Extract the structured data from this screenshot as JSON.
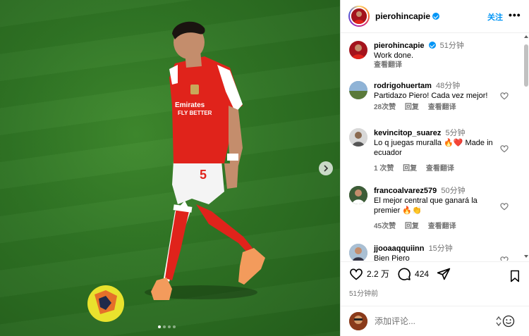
{
  "post": {
    "username": "pierohincapie",
    "follow_label": "关注",
    "more_label": "•••",
    "caption": {
      "username": "pierohincapie",
      "time": "51分钟",
      "text": "Work done.",
      "translate": "查看翻译"
    },
    "image": {
      "jersey_sponsor": "Emirates FLY BETTER",
      "jersey_number": "5",
      "carousel_dots": 4,
      "active_dot": 1
    }
  },
  "comments": [
    {
      "user": "rodrigohuertam",
      "time": "48分钟",
      "text": "Partidazo Piero! Cada vez mejor!",
      "likes": "28次赞",
      "reply": "回复",
      "translate": "查看翻译"
    },
    {
      "user": "kevincitop_suarez",
      "time": "5分钟",
      "text": "Lo q juegas muralla 🔥❤️ Made in ecuador",
      "likes": "1 次赞",
      "reply": "回复",
      "translate": "查看翻译"
    },
    {
      "user": "francoalvarez579",
      "time": "50分钟",
      "text": "El mejor central que ganará la premier 🔥👏",
      "likes": "45次赞",
      "reply": "回复",
      "translate": "查看翻译"
    },
    {
      "user": "jjooaaqquiinn",
      "time": "15分钟",
      "text": "Bien Piero",
      "likes": "",
      "reply": "",
      "translate": ""
    }
  ],
  "actions": {
    "like_count": "2.2 万",
    "comment_count": "424",
    "posted": "51分钟前"
  },
  "add_comment": {
    "placeholder": "添加评论..."
  },
  "colors": {
    "accent": "#0095f6",
    "kit_red": "#e0231b",
    "pitch": "#2f7424"
  }
}
